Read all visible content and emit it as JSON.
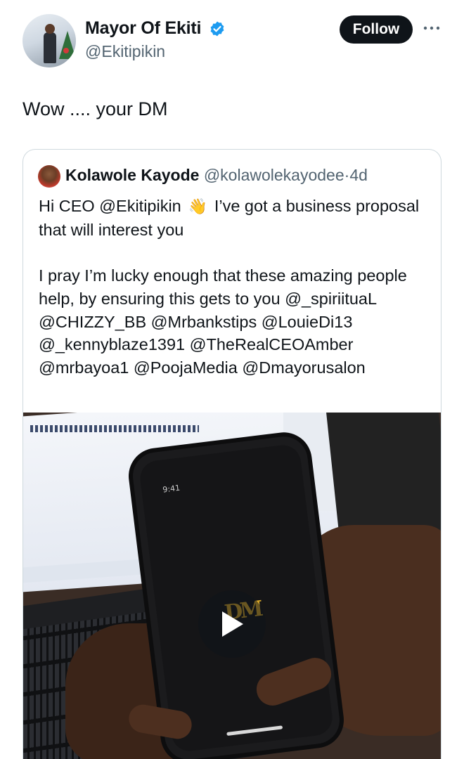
{
  "author": {
    "name": "Mayor Of Ekiti",
    "handle": "@Ekitipikin",
    "verified": true,
    "verified_color": "#1d9bf0"
  },
  "actions": {
    "follow_label": "Follow",
    "more_icon": "more-horizontal-icon"
  },
  "tweet": {
    "text": "Wow .... your DM"
  },
  "quoted_tweet": {
    "name": "Kolawole Kayode",
    "handle": "@kolawolekayodee",
    "separator": "·",
    "time": "4d",
    "line1_before_emoji": "Hi CEO @Ekitipikin",
    "emoji": "👋",
    "line1_after_emoji": "I’ve got a business proposal that will interest you",
    "paragraph2": "I pray I’m lucky enough that these amazing people help, by ensuring this gets to you @_spiriituaL @CHIZZY_BB @Mrbankstips @LouieDi13 @_kennyblaze1391 @TheRealCEOAmber @mrbayoa1 @PoojaMedia @Dmayorusalon",
    "video": {
      "phone_time": "9:41",
      "phone_logo": "DM",
      "play_icon": "play-icon"
    }
  },
  "colors": {
    "text_primary": "#0f1419",
    "text_secondary": "#536471",
    "border": "#cfd9de",
    "follow_bg": "#0f1419"
  }
}
